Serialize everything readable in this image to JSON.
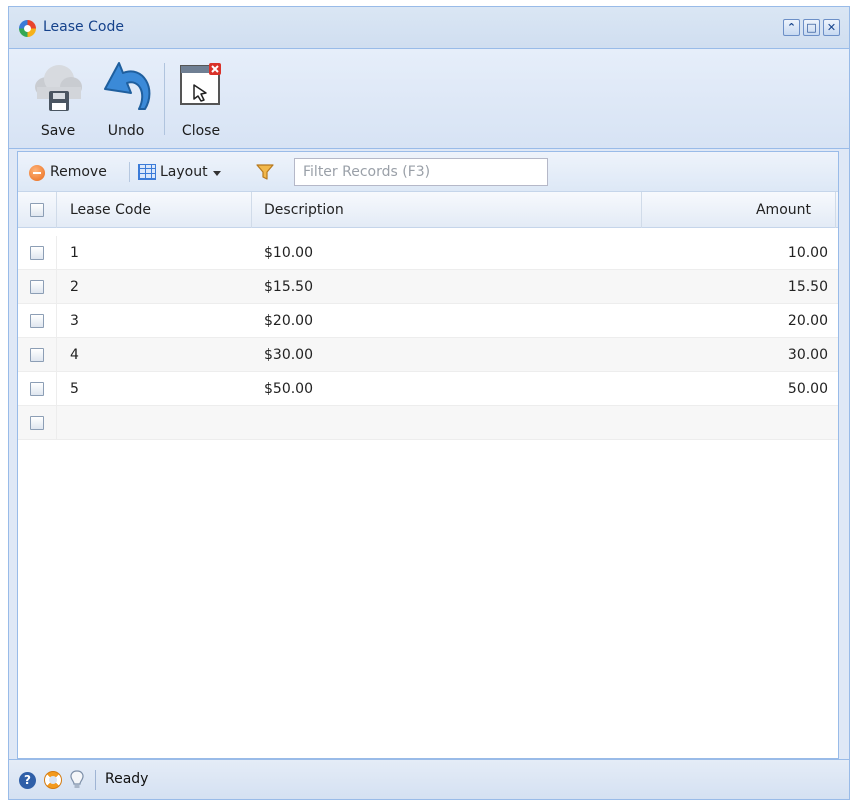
{
  "window": {
    "title": "Lease Code",
    "app_icon": "app-logo-icon",
    "controls": [
      "restore-icon",
      "maximize-icon",
      "close-window-icon"
    ]
  },
  "toolbar": {
    "save_label": "Save",
    "undo_label": "Undo",
    "close_label": "Close"
  },
  "grid_toolbar": {
    "remove_label": "Remove",
    "layout_label": "Layout",
    "filter_placeholder": "Filter Records (F3)"
  },
  "grid": {
    "columns": {
      "code": "Lease Code",
      "description": "Description",
      "amount": "Amount"
    },
    "rows": [
      {
        "code": "1",
        "description": "$10.00",
        "amount": "10.00"
      },
      {
        "code": "2",
        "description": "$15.50",
        "amount": "15.50"
      },
      {
        "code": "3",
        "description": "$20.00",
        "amount": "20.00"
      },
      {
        "code": "4",
        "description": "$30.00",
        "amount": "30.00"
      },
      {
        "code": "5",
        "description": "$50.00",
        "amount": "50.00"
      }
    ]
  },
  "status": {
    "text": "Ready"
  },
  "colors": {
    "frame_border": "#99bbe8",
    "title_text": "#15428b",
    "panel_bg": "#dfe8f6"
  }
}
